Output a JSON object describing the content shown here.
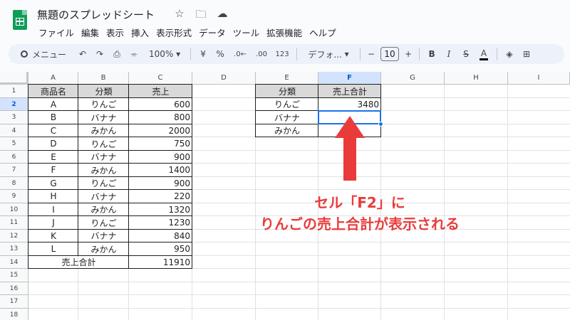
{
  "app": {
    "title": "無題のスプレッドシート",
    "menus": [
      "ファイル",
      "編集",
      "表示",
      "挿入",
      "表示形式",
      "データ",
      "ツール",
      "拡張機能",
      "ヘルプ"
    ]
  },
  "toolbar": {
    "search_label": "メニュー",
    "zoom": "100%",
    "currency": "¥",
    "percent": "%",
    "dec_decrease": ".0←",
    "dec_increase": ".00",
    "number_format": "123",
    "font": "デフォ...",
    "font_size": "10",
    "minus": "−",
    "plus": "+",
    "bold": "B",
    "italic": "I",
    "strike": "S",
    "text_color": "A"
  },
  "columns": [
    "A",
    "B",
    "C",
    "D",
    "E",
    "F",
    "G",
    "H",
    "I"
  ],
  "rows": [
    "1",
    "2",
    "3",
    "4",
    "5",
    "6",
    "7",
    "8",
    "9",
    "10",
    "11",
    "12",
    "13",
    "14",
    "15",
    "16",
    "17",
    "18"
  ],
  "table1": {
    "headers": [
      "商品名",
      "分類",
      "売上"
    ],
    "rows": [
      [
        "A",
        "りんご",
        "600"
      ],
      [
        "B",
        "バナナ",
        "800"
      ],
      [
        "C",
        "みかん",
        "2000"
      ],
      [
        "D",
        "りんご",
        "750"
      ],
      [
        "E",
        "バナナ",
        "900"
      ],
      [
        "F",
        "みかん",
        "1400"
      ],
      [
        "G",
        "りんご",
        "900"
      ],
      [
        "H",
        "バナナ",
        "220"
      ],
      [
        "I",
        "みかん",
        "1320"
      ],
      [
        "J",
        "りんご",
        "1230"
      ],
      [
        "K",
        "バナナ",
        "840"
      ],
      [
        "L",
        "みかん",
        "950"
      ]
    ],
    "total_label": "売上合計",
    "total_value": "11910"
  },
  "table2": {
    "headers": [
      "分類",
      "売上合計"
    ],
    "rows": [
      [
        "りんご",
        "3480"
      ],
      [
        "バナナ",
        ""
      ],
      [
        "みかん",
        ""
      ]
    ]
  },
  "annotation": {
    "line1": "セル「F2」に",
    "line2": "りんごの売上合計が表示される",
    "color": "#ea3b3b"
  }
}
